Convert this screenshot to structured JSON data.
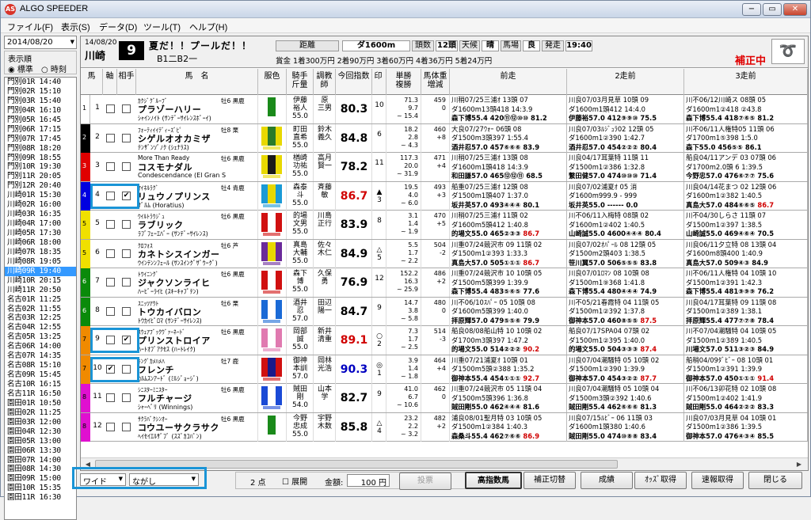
{
  "app": {
    "title": "ALGO SPEEDER",
    "icon": "AS"
  },
  "menu": [
    "ファイル(F)",
    "表示(S)",
    "データ(D)",
    "ツール(T)",
    "ヘルプ(H)"
  ],
  "left": {
    "date": "2014/08/20",
    "order_label": "表示順",
    "order_opt1": "標準",
    "order_opt2": "時刻",
    "races": [
      "門別01R 14:40",
      "門別02R 15:10",
      "門別03R 15:40",
      "門別04R 16:10",
      "門別05R 16:45",
      "門別06R 17:15",
      "門別07R 17:45",
      "門別08R 18:20",
      "門別09R 18:55",
      "門別10R 19:30",
      "門別11R 20:05",
      "門別12R 20:40",
      "川崎01R 15:30",
      "川崎02R 16:00",
      "川崎03R 16:35",
      "川崎04R 17:00",
      "川崎05R 17:30",
      "川崎06R 18:00",
      "川崎07R 18:35",
      "川崎08R 19:05",
      "川崎09R 19:40",
      "川崎10R 20:15",
      "川崎11R 20:50",
      "名古01R 11:25",
      "名古02R 11:55",
      "名古03R 12:25",
      "名古04R 12:55",
      "名古05R 13:25",
      "名古06R 14:00",
      "名古07R 14:35",
      "名古08R 15:10",
      "名古09R 15:45",
      "名古10R 16:15",
      "名古11R 16:50",
      "園田01R 10:50",
      "園田02R 11:25",
      "園田03R 12:00",
      "園田04R 12:30",
      "園田05R 13:00",
      "園田06R 13:30",
      "園田07R 14:00",
      "園田08R 14:30",
      "園田09R 15:00",
      "園田10R 15:35",
      "園田11R 16:30"
    ],
    "selected_race": 20
  },
  "header": {
    "date": "14/08/20",
    "venue": "川崎",
    "race_no": "9",
    "name": "夏だ！！プールだ！！",
    "class": "B1二B2一",
    "dist_label": "距離",
    "dist": "ダ1600m",
    "heads_label": "頭数",
    "heads": "12頭",
    "weather_label": "天候",
    "weather": "晴",
    "track_label": "馬場",
    "track": "良",
    "post_label": "発走",
    "post": "19:40",
    "prize": "賞金 1着300万円 2着90万円 3着60万円 4着36万円 5着24万円",
    "hosei": "補正中",
    "logo": "➰"
  },
  "columns": [
    "馬",
    "軸",
    "相手",
    "馬　名",
    "服色",
    "騎手\n斤量",
    "調教\n師",
    "今回指数",
    "印",
    "単勝\n複勝",
    "馬体重\n増減",
    "前走",
    "2走前",
    "3走前"
  ],
  "horses": [
    {
      "frame": "1",
      "fcolor": "#ffffff",
      "num": "1",
      "axis": false,
      "partner": false,
      "kana": "ｶｸｼﾞｸﾞﾙｰﾌﾞ",
      "sex": "牡6 黒鹿",
      "name": "プラゾーハリー",
      "sire": "ｼｬｲﾝﾉｲﾄ (ｻﾝﾃﾞｰｻｲﾚﾝｽﾎﾞｰｲ)",
      "jockey": "伊藤\n裕人\n55.0",
      "trainer": "原\n三男",
      "idx": "80.3",
      "idxcolor": "#000",
      "mark": "10",
      "odds": "71.3\n9.7\n~ 15.4",
      "wt": "459\n0\n",
      "r1": [
        "川稍07/25三浦ｵ 13頭 07",
        "ダ1600m13頭418 14:3.9",
        "森下博55.4 420⑪⑫⑩⑩ 81.2"
      ],
      "r2": [
        "川良07/03月見草 10頭 09",
        "ダ1600m1頭412 14:4.0",
        "伊藤裕57.0 412⑨⑨⑩ 75.5"
      ],
      "r3": [
        "川不06/12川崎ス 08頭 05",
        "ダ1600m1②418 ②43.8",
        "森下博55.4 418⑦⑥⑤ 81.2"
      ],
      "c1": "#000",
      "c2": "#000",
      "c3": "#000",
      "s1": "#ffffff",
      "s2": "#1a8a1a",
      "s3": "#ffffff"
    },
    {
      "frame": "2",
      "fcolor": "#000000",
      "num": "2",
      "axis": false,
      "partner": false,
      "kana": "ﾌｫｰﾃｨｲｲﾃﾞｨｰｽﾞﾋﾟ",
      "sex": "牡8 栗",
      "name": "シゲルオオカミザ",
      "sire": "ﾃﾝｻﾞﾝｿﾞﾉｸ (ｼｪﾅﾗｽ)",
      "jockey": "町田\n直希\n55.0",
      "trainer": "鈴木\n義久",
      "idx": "84.8",
      "idxcolor": "#000",
      "mark": "6",
      "odds": "18.2\n2.8\n~ 4.3",
      "wt": "460\n+8\n",
      "r1": [
        "大良07/27ｳｫｰ 06頭 08",
        "ダ1500m3頭397 1:55.4",
        "酒井忍57.0 457⑥⑥⑥ 83.9"
      ],
      "r2": [
        "川良07/03ﾙｼﾞｭﾗ02 12頭 05",
        "ダ1600m1②390 1:42.7",
        "酒井忍57.0 454②②② 80.4"
      ],
      "r3": [
        "川不06/11人権特05 11頭 06",
        "ダ1700m1⑤398 1:5.0",
        "森下55.0 456⑤⑤ 86.1"
      ],
      "c1": "#000",
      "c2": "#000",
      "c3": "#000",
      "s1": "#e8d800",
      "s2": "#2a7a2a",
      "s3": "#e8d800"
    },
    {
      "frame": "3",
      "fcolor": "#e00000",
      "num": "3",
      "axis": false,
      "partner": false,
      "kana": "More Than Ready",
      "sex": "牡6 黒鹿",
      "name": "コスモナダル",
      "sire": "Condescendance (El Gran S",
      "jockey": "楢崎\n功祐\n55.0",
      "trainer": "高月\n賢一",
      "idx": "78.2",
      "idxcolor": "#000",
      "mark": "11",
      "odds": "117.3\n20.0\n~ 31.9",
      "wt": "471\n+4\n",
      "r1": [
        "川稍07/25三浦ｵ 13頭 08",
        "ダ1600m1頭418 14:3.9",
        "和田謙57.0 465⑫⑫⑪ 68.5"
      ],
      "r2": [
        "川良04/17耳葉特 11頭 11",
        "ダ1500m1②386 1:32.8",
        "繋田健57.0 474⑩⑩⑩ 71.4"
      ],
      "r3": [
        "船良04/11アンデ 03 07頭 06",
        "ダ1700m2.0頭 6 1:39.5",
        "今野忠57.0 476⑥⑦⑦ 75.6"
      ],
      "c1": "#000",
      "c2": "#000",
      "c3": "#000",
      "s1": "#e8d800",
      "s2": "#1a1a1a",
      "s3": "#e8d800"
    },
    {
      "frame": "4",
      "fcolor": "#0000e0",
      "num": "4",
      "axis": false,
      "partner": true,
      "kana": "ﾏｲﾈﾙﾗｸﾞ",
      "sex": "牡4 青鹿",
      "name": "リュウノプリンス",
      "sire": "ｻﾞﾙﾑ (Horatius)",
      "jockey": "森泰\n斗\n55.0",
      "trainer": "斉藤\n敏",
      "idx": "86.7",
      "idxcolor": "#d00000",
      "mark": "▲\n3",
      "odds": "19.5\n4.0\n~ 6.0",
      "wt": "493\n+3\n",
      "r1": [
        "船重07/25三浦ｵ 12頭 08",
        "ダ1500m1頭407 1:37.0",
        "坂井英57.0 493④④④ 80.1"
      ],
      "r2": [
        "川良07/02浦夏ｵ 05 消",
        "ダ1600m999.9 - 999",
        "坂井英55.0 ------ 0.0"
      ],
      "r3": [
        "川良04/14花まつ 02 12頭 06",
        "ダ1600m1②382 1:40.5",
        "真島大57.0 484⑥⑥⑤ 86.7"
      ],
      "c1": "#000",
      "c2": "#000",
      "c3": "#000",
      "s1": "#1a9ad6",
      "s2": "#e8d800",
      "s3": "#1a9ad6"
    },
    {
      "frame": "5",
      "fcolor": "#f0e000",
      "num": "5",
      "axis": false,
      "partner": false,
      "kana": "ｳｲﾙﾄﾗｳｼﾞｭ",
      "sex": "牡6 黒鹿",
      "name": "ラブリック",
      "sire": "ﾗﾌﾞﾌｪｰｴﾊﾞｰ (ｻﾝﾃﾞｰｻｲﾚﾝｽ)",
      "jockey": "的場\n文男\n55.0",
      "trainer": "川島\n正行",
      "idx": "83.9",
      "idxcolor": "#000",
      "mark": "8",
      "odds": "3.1\n1.4\n~ 1.9",
      "wt": "470\n+5\n",
      "r1": [
        "川稍07/25三浦ｵ 11頭 02",
        "ダ1600m5頭412 1:40.8",
        "的場文55.0 465②③③ 86.7"
      ],
      "r2": [
        "川不06/11入梅特 08頭 02",
        "ダ1600m1②402 1:40.5",
        "山崎誠55.0 4600④④④ 80.4"
      ],
      "r3": [
        "川不04/30しらさ 11頭 07",
        "ダ1500m1②397 1:38.5",
        "山崎誠55.0 469④⑥④ 70.5"
      ],
      "c1": "#000",
      "c2": "#000",
      "c3": "#000",
      "s1": "#d01010",
      "s2": "#ffffff",
      "s3": "#d01010"
    },
    {
      "frame": "5",
      "fcolor": "#f0e000",
      "num": "6",
      "axis": false,
      "partner": false,
      "kana": "ｸﾛﾌｫｽ",
      "sex": "牡6 芦",
      "name": "カネトシスインガー",
      "sire": "ｳｲﾝﾃﾝﾝﾌｪｰﾙ (ｻﾝｽｲﾝｸﾞｻﾞｳｰｸﾞ)",
      "jockey": "真島\n大輔\n55.0",
      "trainer": "佐々\n木仁",
      "idx": "84.9",
      "idxcolor": "#000",
      "mark": "△\n5",
      "odds": "5.5\n1.7\n~ 2.2",
      "wt": "504\n-2\n",
      "r1": [
        "川重07/24競沢市 09 11頭 02",
        "ダ1500m1②393 1:33.3",
        "真島大57.0 505①①① 86.7"
      ],
      "r2": [
        "川良07/02ｵﾊﾟｰﾙ 08 12頭 05",
        "ダ1500m2頭403 1:38.5",
        "笹川翼57.0 506⑤⑤⑤ 83.8"
      ],
      "r3": [
        "川良06/11夕立特 08 13頭 04",
        "ダ1600m8頭400 1:40.9",
        "真島大57.0 509④③ 84.9"
      ],
      "c1": "#000",
      "c2": "#000",
      "c3": "#000",
      "s1": "#6a2a9a",
      "s2": "#e8d800",
      "s3": "#6a2a9a"
    },
    {
      "frame": "6",
      "fcolor": "#0a8a0a",
      "num": "7",
      "axis": false,
      "partner": false,
      "kana": "ﾄﾜｲﾆﾝｸﾞ",
      "sex": "牡6 黒鹿",
      "name": "ジャクソンライヒ",
      "sire": "ﾊｰﾋﾞｰﾗｲﾋ (ｽｷｰｷｬﾌﾟﾃﾝ)",
      "jockey": "森下\n博\n55.0",
      "trainer": "久保\n勇",
      "idx": "76.9",
      "idxcolor": "#000",
      "mark": "12",
      "odds": "152.2\n16.3\n~ 25.9",
      "wt": "486\n+2\n",
      "r1": [
        "川重07/24競沢市 10 10頭 05",
        "ダ1500m5頭399 1:39.9",
        "森下博55.4 483⑤⑥⑤ 77.6"
      ],
      "r2": [
        "川良07/01ﾛﾏﾝ 08 10頭 08",
        "ダ1500m1⑨368 1:41.8",
        "森下博55.4 480④④④ 74.9"
      ],
      "r3": [
        "川不06/11人権特 04 10頭 10",
        "ダ1500m1②391 1:42.3",
        "森下博55.4 481⑨⑨⑨ 76.2"
      ],
      "c1": "#000",
      "c2": "#000",
      "c3": "#000",
      "s1": "#d01010",
      "s2": "#ffffff",
      "s3": "#d01010"
    },
    {
      "frame": "6",
      "fcolor": "#0a8a0a",
      "num": "8",
      "axis": false,
      "partner": false,
      "kana": "ｽﾆｯﾂｱｳﾄ",
      "sex": "牡6 栗",
      "name": "トウカイバロン",
      "sire": "ﾄｳｶｲﾋﾟﾛﾏ (ｻﾝﾃﾞｰｻｲﾚﾝｽ)",
      "jockey": "酒井\n忍\n57.0",
      "trainer": "田辺\n陽一",
      "idx": "84.7",
      "idxcolor": "#000",
      "mark": "9",
      "odds": "14.7\n3.8\n~ 5.8",
      "wt": "480\n0\n",
      "r1": [
        "川不06/10ｽﾊﾟｰ 05 10頭 08",
        "ダ1600m5頭399 1:40.0",
        "拝原輝57.0 479⑤⑤⑥ 79.9"
      ],
      "r2": [
        "川不05/21春霞特 04 11頭 05",
        "ダ1500m1②392 1:37.8",
        "御神本57.0 460⑧⑤⑤ 87.5"
      ],
      "r3": [
        "川良04/17耳葉特 09 11頭 08",
        "ダ1500m1②389 1:38.1",
        "拝原輝55.4 477⑦⑦⑧ 78.4"
      ],
      "c1": "#000",
      "c2": "#000",
      "c3": "#000",
      "s1": "#1a6ad6",
      "s2": "#ffffff",
      "s3": "#1a6ad6"
    },
    {
      "frame": "7",
      "fcolor": "#f08a00",
      "num": "9",
      "axis": false,
      "partner": true,
      "kana": "ｽｳｪｱﾌﾞｯｸｳﾞｧｰﾈｰﾄﾞ",
      "sex": "牡6 黒鹿",
      "name": "プリンストロイア",
      "sire": "ﾊｰﾄｵﾌﾞｱｸｾｽ (ﾊｰﾄﾚｲｸ)",
      "jockey": "岡部\n誠\n55.0",
      "trainer": "新井\n清重",
      "idx": "89.1",
      "idxcolor": "#d00000",
      "mark": "○\n2",
      "odds": "7.3\n1.7\n~ 2.5",
      "wt": "514\n-3\n",
      "r1": [
        "船良08/08船山特 10 10頭 02",
        "ダ1700m3頭397 1:47.2",
        "的場文55.0 514②②② 90.2"
      ],
      "r2": [
        "船良07/17SPA04 07頭 02",
        "ダ1500m1②395 1:40.0",
        "的場文55.0 504③③③ 87.4"
      ],
      "r3": [
        "川不07/04潮騒特 04 10頭 05",
        "ダ1500m1②389 1:40.5",
        "川場文57.0 511③②③ 84.9"
      ],
      "c1": "#000",
      "c2": "#000",
      "c3": "#000",
      "s1": "#e07ab0",
      "s2": "#ffffff",
      "s3": "#e07ab0"
    },
    {
      "frame": "7",
      "fcolor": "#f08a00",
      "num": "10",
      "axis": true,
      "partner": false,
      "kana": "ｷﾝｸﾞｶﾒﾊﾒﾊ",
      "sex": "牡7 鹿",
      "name": "フレンチ",
      "sire": "ｶﾙﾑｽﾝｱｰﾄﾞ (ﾐﾙｼﾞｮｰｼﾞ)",
      "jockey": "御神\n本訓\n57.0",
      "trainer": "岡林\n光浩",
      "idx": "90.3",
      "idxcolor": "#0000c0",
      "mark": "◎\n1",
      "odds": "3.9\n1.4\n~ 1.8",
      "wt": "464\n+4\n",
      "r1": [
        "川重07/21浦夏ｵ 10頭 01",
        "ダ1500m5頭②388 1:35.2",
        "御神本55.4 454①①① 92.7"
      ],
      "r2": [
        "川良07/04潮騒特 05 10頭 02",
        "ダ1500m1②390 1:39.9",
        "御神本57.0 454③②② 87.7"
      ],
      "r3": [
        "船稍04/09ﾀﾞﾋﾞｰ 08 10頭 01",
        "ダ1500m1②391 1:39.9",
        "御神本57.0 450①①① 91.4"
      ],
      "c1": "#000",
      "c2": "#000",
      "c3": "#000",
      "s1": "#d01010",
      "s2": "#1a1a8a",
      "s3": "#d01010"
    },
    {
      "frame": "8",
      "fcolor": "#e010d0",
      "num": "11",
      "axis": false,
      "partner": false,
      "kana": "ｼﾆｽﾀｰﾐﾆｽﾀｰ",
      "sex": "牡6 黒鹿",
      "name": "フルチャージ",
      "sire": "ｼｬｰﾍﾞﾘ (Winnings)",
      "jockey": "賊田\n剛\n54.0",
      "trainer": "山本\n学",
      "idx": "82.7",
      "idxcolor": "#000",
      "mark": "9",
      "odds": "41.0\n6.7\n~ 10.6",
      "wt": "462\n0\n",
      "r1": [
        "川重07/24競沢市 05 11頭 04",
        "ダ1500m5頭396 1:36.8",
        "賊田剛55.0 462④④④ 81.6"
      ],
      "r2": [
        "川良07/04潮騒特 05 10頭 04",
        "ダ1500m3頭②392 1:40.6",
        "賊田剛55.4 462⑥⑥⑥ 81.3"
      ],
      "r3": [
        "川不06/13卯花特 02 10頭 08",
        "ダ1500m1②402 1:41.9",
        "賊田剛55.0 464②②② 83.3"
      ],
      "c1": "#000",
      "c2": "#000",
      "c3": "#000",
      "s1": "#1a4ad6",
      "s2": "#ffffff",
      "s3": "#1a4ad6"
    },
    {
      "frame": "8",
      "fcolor": "#e010d0",
      "num": "12",
      "axis": false,
      "partner": false,
      "kana": "ｻｸﾗﾊﾞｸｼﾝｵｰ",
      "sex": "牡6 黒鹿",
      "name": "コウユーサクラサク",
      "sire": "ﾍｲｾｲｴﾙｻﾞﾌﾞ (ｽｽﾞｶｺﾊﾟﾝ)",
      "jockey": "今野\n忠成\n55.0",
      "trainer": "宇野\n木数",
      "idx": "85.8",
      "idxcolor": "#000",
      "mark": "△\n4",
      "odds": "23.2\n2.2\n~ 3.2",
      "wt": "482\n+2\n",
      "r1": [
        "浦良08/01聖月特 03 10頭 05",
        "ダ1500m1②384 1:40.3",
        "森桑斗55.4 462⑦⑥⑥ 86.9"
      ],
      "r2": [
        "川良07/15ﾙﾋﾞｰ 06 11頭 03",
        "ダ1600m1頭380 1:40.6",
        "賊田剛55.0 474⑩⑧⑧ 83.4"
      ],
      "r3": [
        "川良07/03月見草 04 10頭 01",
        "ダ1500m1②386 1:39.5",
        "御神本57.0 476④③④ 85.5"
      ],
      "c1": "#000",
      "c2": "#000",
      "c3": "#000",
      "s1": "#ffffff",
      "s2": "#1a8a1a",
      "s3": "#ffffff"
    }
  ],
  "bottom": {
    "bet_type": "ワイド",
    "bet_method": "ながし",
    "points": "2 点",
    "expand_label": "展開",
    "amount_label": "金額:",
    "amount": "100 円",
    "vote": "投票",
    "buttons": [
      "高指数馬",
      "補正切替",
      "成績",
      "ｵｯｽﾞ取得",
      "速報取得",
      "閉じる"
    ]
  },
  "colors": {
    "selection": "#3399ff",
    "highlight": "#1a94d6",
    "hosei": "#e00000"
  }
}
